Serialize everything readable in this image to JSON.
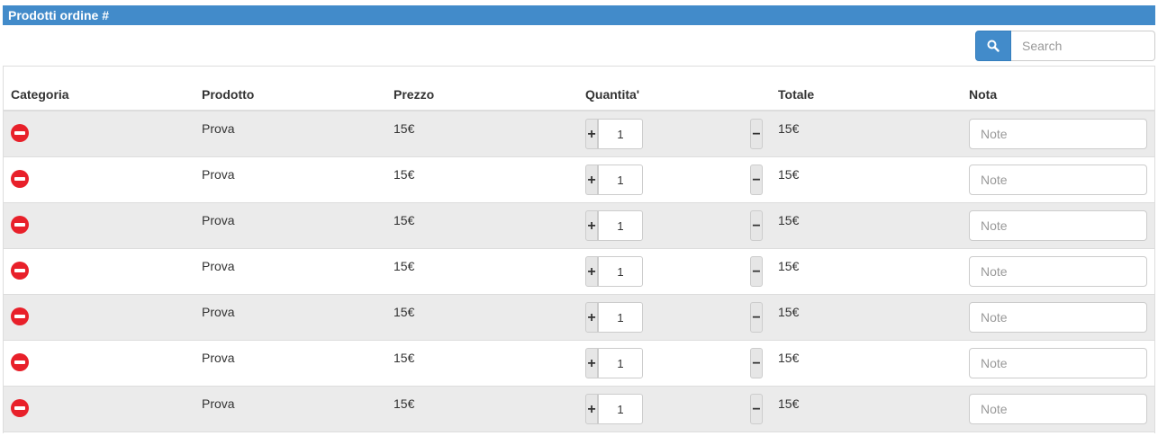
{
  "header": {
    "title": "Prodotti ordine #"
  },
  "search": {
    "placeholder": "Search",
    "icon": "search-icon"
  },
  "columns": [
    "Categoria",
    "Prodotto",
    "Prezzo",
    "Quantita'",
    "Totale",
    "Nota"
  ],
  "rows": [
    {
      "prodotto": "Prova",
      "prezzo": "15€",
      "quantita": "1",
      "totale": "15€",
      "nota_placeholder": "Note"
    },
    {
      "prodotto": "Prova",
      "prezzo": "15€",
      "quantita": "1",
      "totale": "15€",
      "nota_placeholder": "Note"
    },
    {
      "prodotto": "Prova",
      "prezzo": "15€",
      "quantita": "1",
      "totale": "15€",
      "nota_placeholder": "Note"
    },
    {
      "prodotto": "Prova",
      "prezzo": "15€",
      "quantita": "1",
      "totale": "15€",
      "nota_placeholder": "Note"
    },
    {
      "prodotto": "Prova",
      "prezzo": "15€",
      "quantita": "1",
      "totale": "15€",
      "nota_placeholder": "Note"
    },
    {
      "prodotto": "Prova",
      "prezzo": "15€",
      "quantita": "1",
      "totale": "15€",
      "nota_placeholder": "Note"
    },
    {
      "prodotto": "Prova",
      "prezzo": "15€",
      "quantita": "1",
      "totale": "15€",
      "nota_placeholder": "Note"
    }
  ],
  "buttons": {
    "plus": "+",
    "minus": "−"
  },
  "colors": {
    "header": "#428bca",
    "remove": "#e8202a",
    "stripe": "#ebebeb"
  }
}
